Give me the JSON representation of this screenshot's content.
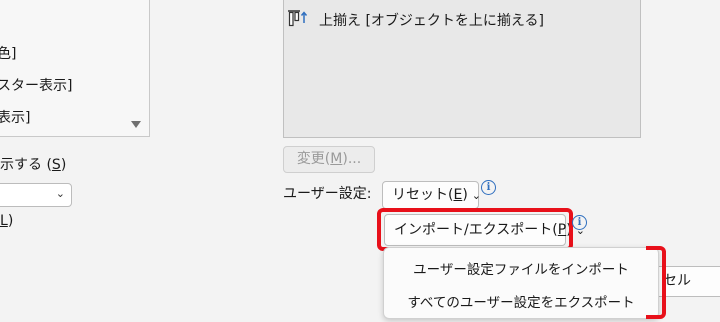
{
  "left_panel": {
    "list_items": [
      "色]",
      "スター表示]",
      "表示]"
    ],
    "checkbox_label_prefix": "示する (",
    "checkbox_label_key": "S",
    "checkbox_label_suffix": ")",
    "bottom_label_key": "L",
    "bottom_label_suffix": ")"
  },
  "right_panel": {
    "command_item": "上揃え [オブジェクトを上に揃える]",
    "change_button_prefix": "変更(",
    "change_button_key": "M",
    "change_button_suffix": ")...",
    "user_settings_label": "ユーザー設定:",
    "reset_button_prefix": "リセット(",
    "reset_button_key": "E",
    "reset_button_suffix": ")",
    "import_export_prefix": "インポート/エクスポート(",
    "import_export_key": "P",
    "import_export_suffix": ")",
    "info_glyph": "i",
    "cancel_partial": "セル"
  },
  "dropdown": {
    "items": [
      "ユーザー設定ファイルをインポート",
      "すべてのユーザー設定をエクスポート"
    ]
  },
  "colors": {
    "highlight": "#e8101a",
    "info": "#2f6fbf"
  },
  "icons": {
    "align_top": "align-top-icon",
    "chevron": "chevron-down-icon",
    "info": "info-icon"
  }
}
